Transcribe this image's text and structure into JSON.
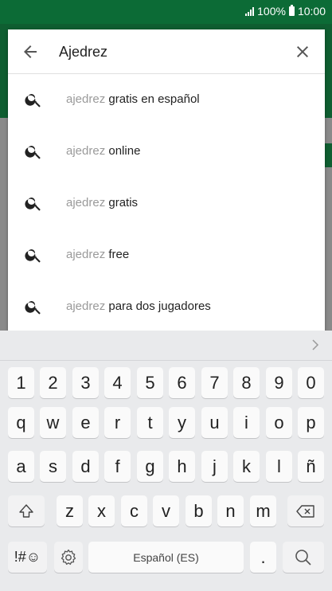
{
  "status_bar": {
    "battery_text": "100%",
    "time": "10:00"
  },
  "search": {
    "query": "Ajedrez",
    "back_icon": "arrow-left-icon",
    "clear_icon": "close-icon",
    "suggestions": [
      {
        "prefix": "ajedrez",
        "suffix": "gratis en español"
      },
      {
        "prefix": "ajedrez",
        "suffix": "online"
      },
      {
        "prefix": "ajedrez",
        "suffix": "gratis"
      },
      {
        "prefix": "ajedrez",
        "suffix": "free"
      },
      {
        "prefix": "ajedrez",
        "suffix": "para dos jugadores"
      }
    ]
  },
  "keyboard": {
    "number_row": [
      "1",
      "2",
      "3",
      "4",
      "5",
      "6",
      "7",
      "8",
      "9",
      "0"
    ],
    "row1": [
      "q",
      "w",
      "e",
      "r",
      "t",
      "y",
      "u",
      "i",
      "o",
      "p"
    ],
    "row2": [
      "a",
      "s",
      "d",
      "f",
      "g",
      "h",
      "j",
      "k",
      "l",
      "ñ"
    ],
    "row3": [
      "z",
      "x",
      "c",
      "v",
      "b",
      "n",
      "m"
    ],
    "symbols_label": "!#☺",
    "space_label": "Español (ES)",
    "period_label": "."
  },
  "colors": {
    "status_bar_bg": "#0c6b36",
    "app_bar_bg": "#0f5e31",
    "keyboard_bg": "#e9eaec"
  }
}
